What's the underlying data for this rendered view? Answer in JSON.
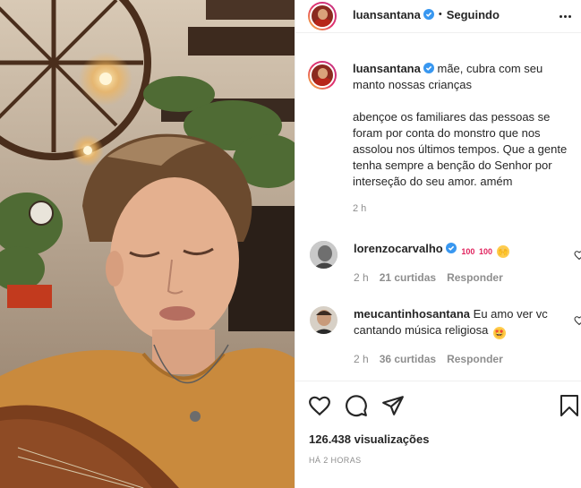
{
  "post": {
    "username": "luansantana",
    "follow_status": "Seguindo",
    "separator": "•",
    "caption_line1": "mãe, cubra com seu manto nossas crianças",
    "caption_line2": "abençoe os familiares das pessoas se foram por conta do monstro que nos assolou nos últimos tempos. Que a gente tenha sempre a benção do Senhor por interseção do seu amor. amém",
    "caption_time": "2 h",
    "views": "126.438 visualizações",
    "posted_ago": "HÁ 2 HORAS"
  },
  "comments": [
    {
      "username": "lorenzocarvalho",
      "text": "",
      "emojis": [
        "100",
        "100",
        "🙌"
      ],
      "time": "2 h",
      "likes": "21 curtidas",
      "reply": "Responder"
    },
    {
      "username": "meucantinhosantana",
      "text": "Eu amo ver vc cantando música religiosa",
      "emojis": [
        "🤩"
      ],
      "time": "2 h",
      "likes": "36 curtidas",
      "reply": "Responder"
    }
  ],
  "icons": {
    "like": "heart-icon",
    "comment": "comment-icon",
    "share": "share-icon",
    "save": "bookmark-icon",
    "more": "more-options-icon",
    "verified": "verified-badge-icon"
  },
  "colors": {
    "verified": "#3897f0",
    "text": "#262626",
    "muted": "#8e8e8e",
    "border": "#efefef"
  }
}
